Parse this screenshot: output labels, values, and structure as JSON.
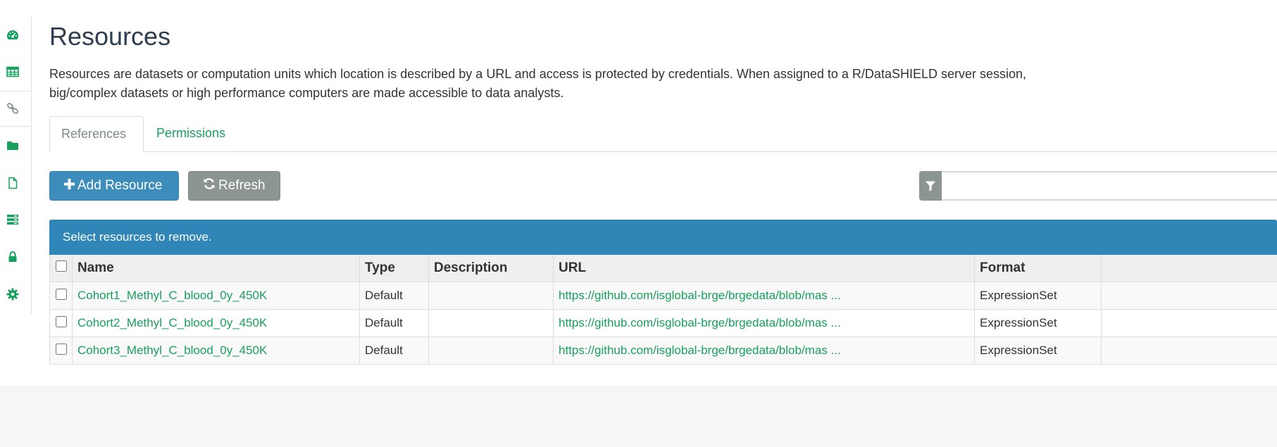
{
  "colors": {
    "accent_green": "#18a05e",
    "primary_blue": "#3c8dbc",
    "banner_blue": "#2f86b7",
    "gray_button": "#8c9494"
  },
  "sidebar": {
    "items": [
      {
        "icon": "dashboard-icon"
      },
      {
        "icon": "table-icon"
      },
      {
        "icon": "link-icon"
      },
      {
        "icon": "folder-icon"
      },
      {
        "icon": "file-icon"
      },
      {
        "icon": "server-icon"
      },
      {
        "icon": "lock-icon"
      },
      {
        "icon": "gear-icon"
      }
    ]
  },
  "page": {
    "title": "Resources",
    "description_line1": "Resources are datasets or computation units which location is described by a URL and access is protected by credentials. When assigned to a R/DataSHIELD server session,",
    "description_line2": "big/complex datasets or high performance computers are made accessible to data analysts."
  },
  "tabs": [
    {
      "label": "References",
      "active": true
    },
    {
      "label": "Permissions",
      "active": false
    }
  ],
  "toolbar": {
    "add_label": "Add Resource",
    "refresh_label": "Refresh",
    "filter_value": ""
  },
  "table": {
    "banner": "Select resources to remove.",
    "columns": [
      "Name",
      "Type",
      "Description",
      "URL",
      "Format"
    ],
    "rows": [
      {
        "name": "Cohort1_Methyl_C_blood_0y_450K",
        "type": "Default",
        "description": "",
        "url": "https://github.com/isglobal-brge/brgedata/blob/mas ...",
        "format": "ExpressionSet"
      },
      {
        "name": "Cohort2_Methyl_C_blood_0y_450K",
        "type": "Default",
        "description": "",
        "url": "https://github.com/isglobal-brge/brgedata/blob/mas ...",
        "format": "ExpressionSet"
      },
      {
        "name": "Cohort3_Methyl_C_blood_0y_450K",
        "type": "Default",
        "description": "",
        "url": "https://github.com/isglobal-brge/brgedata/blob/mas ...",
        "format": "ExpressionSet"
      }
    ]
  }
}
